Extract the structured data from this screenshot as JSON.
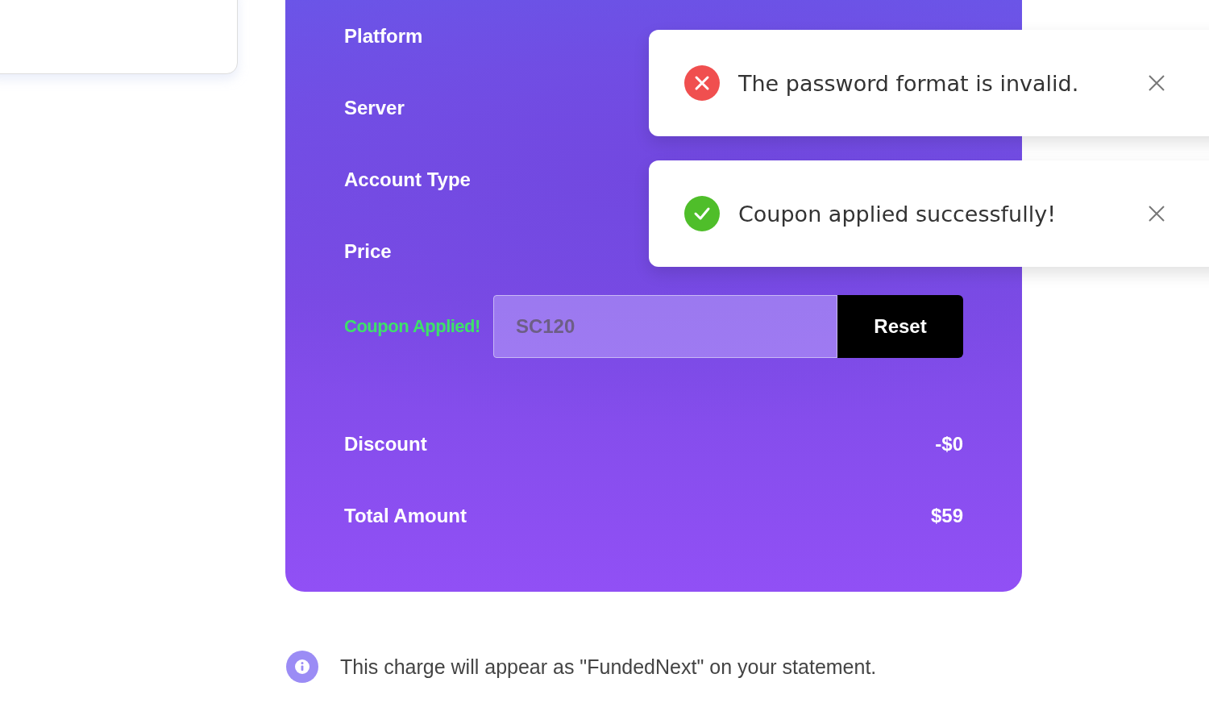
{
  "summary": {
    "rows": [
      {
        "label": "Platform"
      },
      {
        "label": "Server"
      },
      {
        "label": "Account Type"
      },
      {
        "label": "Price"
      }
    ],
    "coupon": {
      "status": "Coupon Applied!",
      "applied": true,
      "value": "SC120",
      "button": "Reset"
    },
    "totals": [
      {
        "label": "Discount",
        "value": "-$0"
      },
      {
        "label": "Total Amount",
        "value": "$59"
      }
    ]
  },
  "note": "This charge will appear as \"FundedNext\" on your statement.",
  "toasts": [
    {
      "kind": "error",
      "message": "The password format is invalid."
    },
    {
      "kind": "success",
      "message": "Coupon applied successfully!"
    }
  ]
}
